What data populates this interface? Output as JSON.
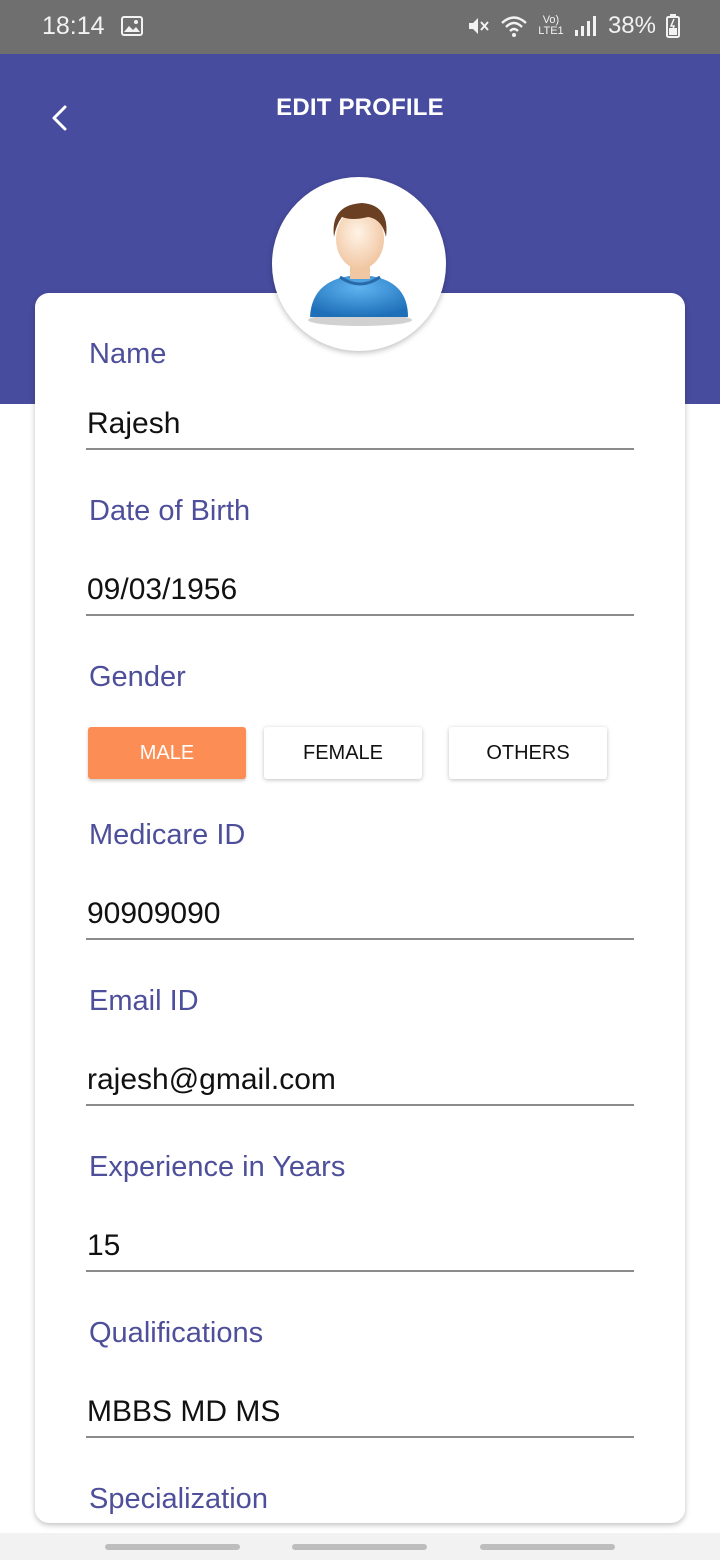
{
  "status_bar": {
    "time": "18:14",
    "network_label": "Vo) LTE1",
    "battery": "38%",
    "icons": [
      "gallery-icon",
      "mute-icon",
      "wifi-icon",
      "signal-icon",
      "battery-icon"
    ]
  },
  "header": {
    "title": "EDIT PROFILE",
    "back_icon": "chevron-left-icon",
    "background_color": "#484c9f"
  },
  "avatar": {
    "icon": "user-avatar-icon"
  },
  "form": {
    "name": {
      "label": "Name",
      "value": "Rajesh"
    },
    "dob": {
      "label": "Date of Birth",
      "value": "09/03/1956"
    },
    "gender": {
      "label": "Gender",
      "options": [
        "MALE",
        "FEMALE",
        "OTHERS"
      ],
      "selected": "MALE",
      "selected_color": "#fc8d55"
    },
    "medicare": {
      "label": "Medicare ID",
      "value": "90909090"
    },
    "email": {
      "label": "Email ID",
      "value": "rajesh@gmail.com"
    },
    "experience": {
      "label": "Experience in Years",
      "value": "15"
    },
    "qualifications": {
      "label": "Qualifications",
      "value": "MBBS MD MS"
    },
    "specialization": {
      "label": "Specialization"
    }
  },
  "colors": {
    "label": "#4e4f9a",
    "accent": "#fc8d55"
  }
}
